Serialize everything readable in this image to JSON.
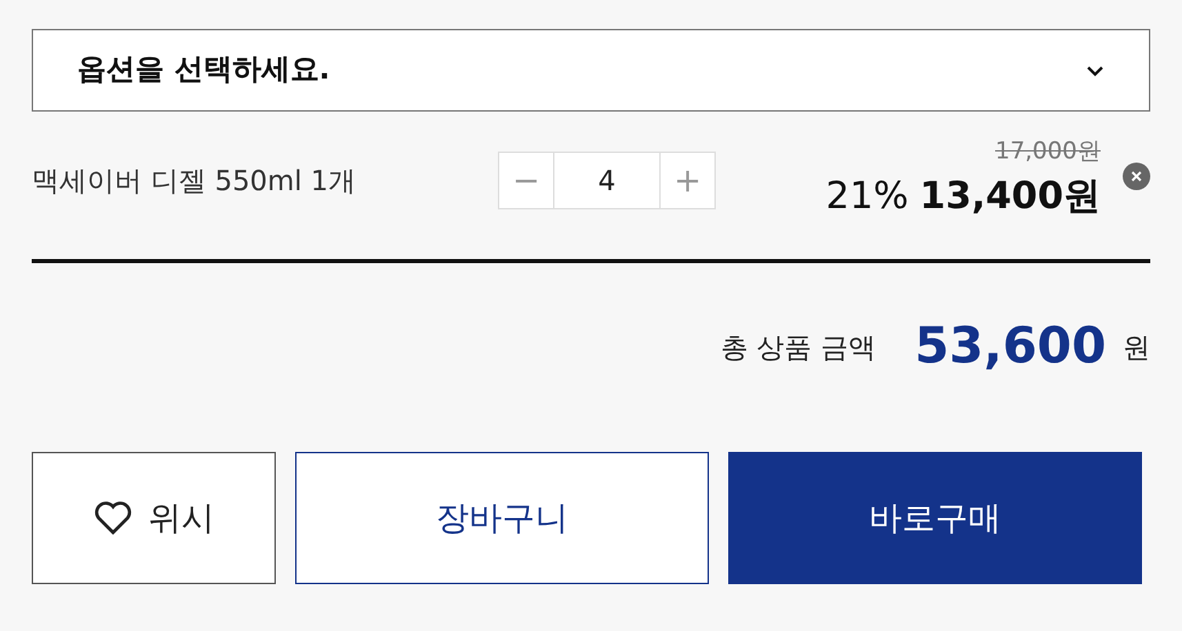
{
  "option_select": {
    "placeholder": "옵션을 선택하세요."
  },
  "item": {
    "name": "맥세이버 디젤 550ml 1개",
    "quantity": "4",
    "minus": "−",
    "plus": "+",
    "original_price": "17,000원",
    "discount": "21%",
    "price": "13,400원"
  },
  "total": {
    "label": "총 상품 금액",
    "amount": "53,600",
    "unit": "원"
  },
  "buttons": [
    {
      "kind": "wish",
      "label": "위시"
    },
    {
      "kind": "cart",
      "label": "장바구니"
    },
    {
      "kind": "buy",
      "label": "바로구매"
    }
  ]
}
